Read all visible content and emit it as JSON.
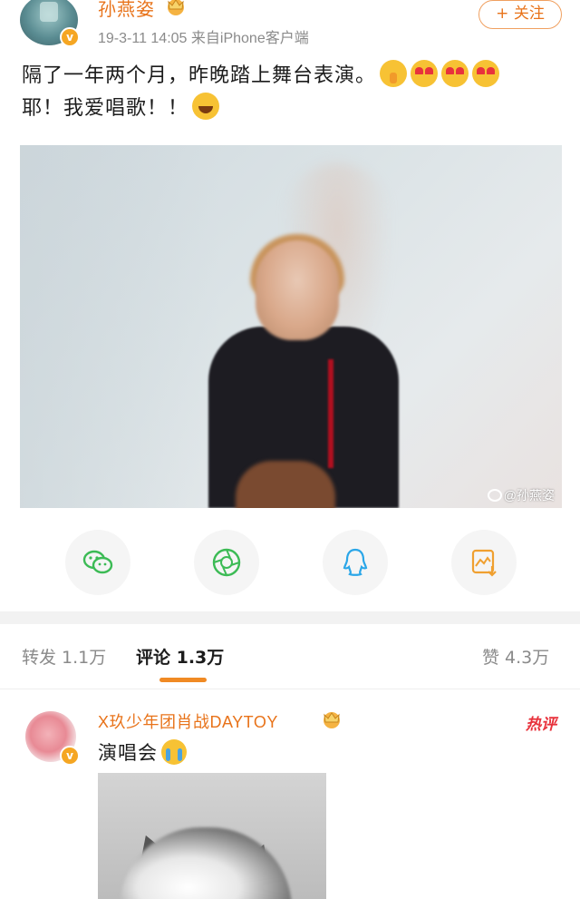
{
  "post": {
    "username": "孙燕姿",
    "meta": "19-3-11 14:05  来自iPhone客户端",
    "follow_label": "+ 关注",
    "text_line1": "隔了一年两个月，昨晚踏上舞台表演。",
    "text_line2": "耶！我爱唱歌！！",
    "watermark": "@孙燕姿",
    "verified_mark": "v"
  },
  "share": {
    "icons": [
      "wechat-icon",
      "moments-icon",
      "qq-icon",
      "save-image-icon"
    ],
    "colors": {
      "wechat": "#3cbb55",
      "moments": "#3cbb55",
      "qq": "#2aa6e8",
      "save": "#f0a030"
    }
  },
  "tabs": {
    "repost": "转发 1.1万",
    "comments": "评论 1.3万",
    "likes": "赞 4.3万"
  },
  "comment": {
    "username": "X玖少年团肖战DAYTOY",
    "hot_label": "热评",
    "text": "演唱会",
    "verified_mark": "v"
  },
  "colors": {
    "accent": "#e8731a",
    "tab_underline": "#f08a24",
    "hot": "#e8323c"
  }
}
